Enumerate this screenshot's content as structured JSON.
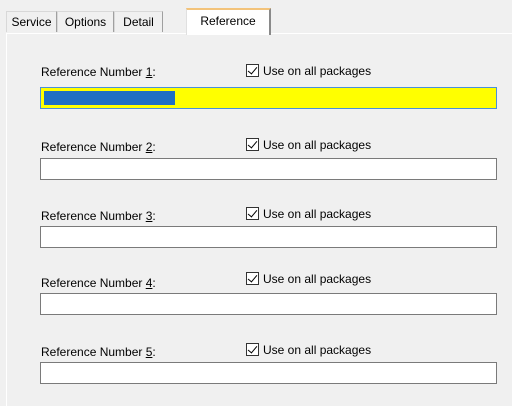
{
  "tabs": [
    {
      "label": "Service",
      "active": false
    },
    {
      "label": "Options",
      "active": false
    },
    {
      "label": "Detail",
      "active": false
    },
    {
      "label": "Reference",
      "active": true
    }
  ],
  "references": [
    {
      "label_prefix": "Reference Number ",
      "accel": "1",
      "label_suffix": ":",
      "checkbox_label": "Use on all packages",
      "checked": true,
      "value": "",
      "field_state": "focused, content selected",
      "field_color": "#ffff00",
      "selection_color": "#1f6fc4"
    },
    {
      "label_prefix": "Reference Number ",
      "accel": "2",
      "label_suffix": ":",
      "checkbox_label": "Use on all packages",
      "checked": true,
      "value": ""
    },
    {
      "label_prefix": "Reference Number ",
      "accel": "3",
      "label_suffix": ":",
      "checkbox_label": "Use on all packages",
      "checked": true,
      "value": ""
    },
    {
      "label_prefix": "Reference Number ",
      "accel": "4",
      "label_suffix": ":",
      "checkbox_label": "Use on all packages",
      "checked": true,
      "value": ""
    },
    {
      "label_prefix": "Reference Number ",
      "accel": "5",
      "label_suffix": ":",
      "checkbox_label": "Use on all packages",
      "checked": true,
      "value": ""
    }
  ]
}
